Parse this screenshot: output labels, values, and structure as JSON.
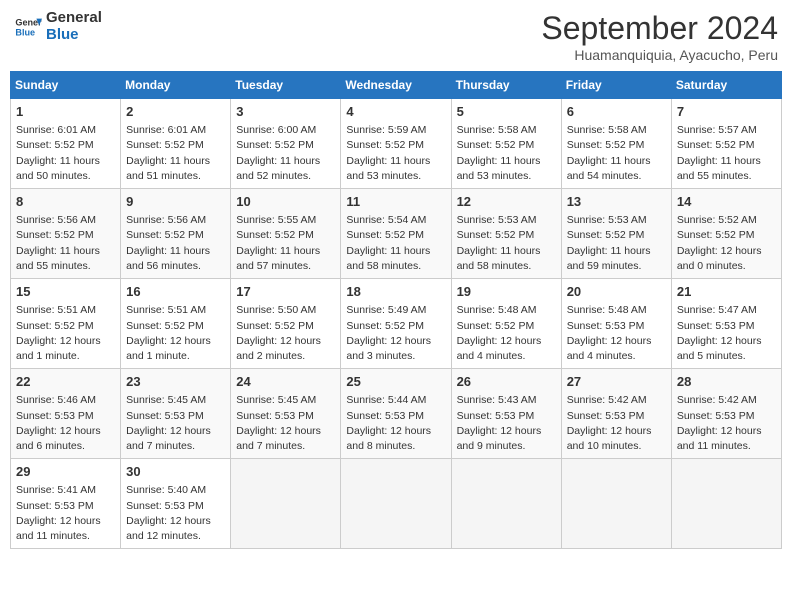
{
  "header": {
    "logo_general": "General",
    "logo_blue": "Blue",
    "month_year": "September 2024",
    "location": "Huamanquiquia, Ayacucho, Peru"
  },
  "weekdays": [
    "Sunday",
    "Monday",
    "Tuesday",
    "Wednesday",
    "Thursday",
    "Friday",
    "Saturday"
  ],
  "weeks": [
    [
      {
        "day": "1",
        "info": "Sunrise: 6:01 AM\nSunset: 5:52 PM\nDaylight: 11 hours\nand 50 minutes."
      },
      {
        "day": "2",
        "info": "Sunrise: 6:01 AM\nSunset: 5:52 PM\nDaylight: 11 hours\nand 51 minutes."
      },
      {
        "day": "3",
        "info": "Sunrise: 6:00 AM\nSunset: 5:52 PM\nDaylight: 11 hours\nand 52 minutes."
      },
      {
        "day": "4",
        "info": "Sunrise: 5:59 AM\nSunset: 5:52 PM\nDaylight: 11 hours\nand 53 minutes."
      },
      {
        "day": "5",
        "info": "Sunrise: 5:58 AM\nSunset: 5:52 PM\nDaylight: 11 hours\nand 53 minutes."
      },
      {
        "day": "6",
        "info": "Sunrise: 5:58 AM\nSunset: 5:52 PM\nDaylight: 11 hours\nand 54 minutes."
      },
      {
        "day": "7",
        "info": "Sunrise: 5:57 AM\nSunset: 5:52 PM\nDaylight: 11 hours\nand 55 minutes."
      }
    ],
    [
      {
        "day": "8",
        "info": "Sunrise: 5:56 AM\nSunset: 5:52 PM\nDaylight: 11 hours\nand 55 minutes."
      },
      {
        "day": "9",
        "info": "Sunrise: 5:56 AM\nSunset: 5:52 PM\nDaylight: 11 hours\nand 56 minutes."
      },
      {
        "day": "10",
        "info": "Sunrise: 5:55 AM\nSunset: 5:52 PM\nDaylight: 11 hours\nand 57 minutes."
      },
      {
        "day": "11",
        "info": "Sunrise: 5:54 AM\nSunset: 5:52 PM\nDaylight: 11 hours\nand 58 minutes."
      },
      {
        "day": "12",
        "info": "Sunrise: 5:53 AM\nSunset: 5:52 PM\nDaylight: 11 hours\nand 58 minutes."
      },
      {
        "day": "13",
        "info": "Sunrise: 5:53 AM\nSunset: 5:52 PM\nDaylight: 11 hours\nand 59 minutes."
      },
      {
        "day": "14",
        "info": "Sunrise: 5:52 AM\nSunset: 5:52 PM\nDaylight: 12 hours\nand 0 minutes."
      }
    ],
    [
      {
        "day": "15",
        "info": "Sunrise: 5:51 AM\nSunset: 5:52 PM\nDaylight: 12 hours\nand 1 minute."
      },
      {
        "day": "16",
        "info": "Sunrise: 5:51 AM\nSunset: 5:52 PM\nDaylight: 12 hours\nand 1 minute."
      },
      {
        "day": "17",
        "info": "Sunrise: 5:50 AM\nSunset: 5:52 PM\nDaylight: 12 hours\nand 2 minutes."
      },
      {
        "day": "18",
        "info": "Sunrise: 5:49 AM\nSunset: 5:52 PM\nDaylight: 12 hours\nand 3 minutes."
      },
      {
        "day": "19",
        "info": "Sunrise: 5:48 AM\nSunset: 5:52 PM\nDaylight: 12 hours\nand 4 minutes."
      },
      {
        "day": "20",
        "info": "Sunrise: 5:48 AM\nSunset: 5:53 PM\nDaylight: 12 hours\nand 4 minutes."
      },
      {
        "day": "21",
        "info": "Sunrise: 5:47 AM\nSunset: 5:53 PM\nDaylight: 12 hours\nand 5 minutes."
      }
    ],
    [
      {
        "day": "22",
        "info": "Sunrise: 5:46 AM\nSunset: 5:53 PM\nDaylight: 12 hours\nand 6 minutes."
      },
      {
        "day": "23",
        "info": "Sunrise: 5:45 AM\nSunset: 5:53 PM\nDaylight: 12 hours\nand 7 minutes."
      },
      {
        "day": "24",
        "info": "Sunrise: 5:45 AM\nSunset: 5:53 PM\nDaylight: 12 hours\nand 7 minutes."
      },
      {
        "day": "25",
        "info": "Sunrise: 5:44 AM\nSunset: 5:53 PM\nDaylight: 12 hours\nand 8 minutes."
      },
      {
        "day": "26",
        "info": "Sunrise: 5:43 AM\nSunset: 5:53 PM\nDaylight: 12 hours\nand 9 minutes."
      },
      {
        "day": "27",
        "info": "Sunrise: 5:42 AM\nSunset: 5:53 PM\nDaylight: 12 hours\nand 10 minutes."
      },
      {
        "day": "28",
        "info": "Sunrise: 5:42 AM\nSunset: 5:53 PM\nDaylight: 12 hours\nand 11 minutes."
      }
    ],
    [
      {
        "day": "29",
        "info": "Sunrise: 5:41 AM\nSunset: 5:53 PM\nDaylight: 12 hours\nand 11 minutes."
      },
      {
        "day": "30",
        "info": "Sunrise: 5:40 AM\nSunset: 5:53 PM\nDaylight: 12 hours\nand 12 minutes."
      },
      {
        "day": "",
        "info": ""
      },
      {
        "day": "",
        "info": ""
      },
      {
        "day": "",
        "info": ""
      },
      {
        "day": "",
        "info": ""
      },
      {
        "day": "",
        "info": ""
      }
    ]
  ]
}
